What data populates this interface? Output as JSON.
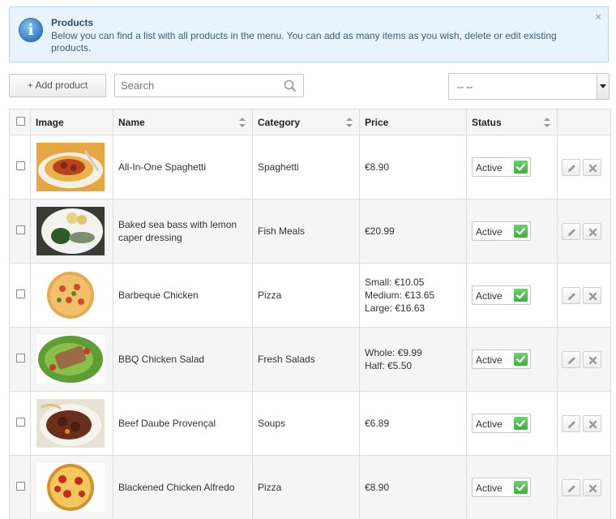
{
  "alert": {
    "title": "Products",
    "text": "Below you can find a list with all products in the menu. You can add as many items as you wish, delete or edit existing products.",
    "close": "×"
  },
  "toolbar": {
    "add_label": "+ Add product",
    "search_placeholder": "Search",
    "filter_value": "-- --"
  },
  "table": {
    "headers": {
      "image": "Image",
      "name": "Name",
      "category": "Category",
      "price": "Price",
      "status": "Status"
    },
    "rows": [
      {
        "name": "All-In-One Spaghetti",
        "category": "Spaghetti",
        "price": [
          "€8.90"
        ],
        "status": "Active",
        "image_icon": "spaghetti-photo"
      },
      {
        "name": "Baked sea bass with lemon caper dressing",
        "category": "Fish Meals",
        "price": [
          "€20.99"
        ],
        "status": "Active",
        "image_icon": "fish-plate-photo"
      },
      {
        "name": "Barbeque Chicken",
        "category": "Pizza",
        "price": [
          "Small: €10.05",
          "Medium: €13.65",
          "Large: €16.63"
        ],
        "status": "Active",
        "image_icon": "pizza-photo"
      },
      {
        "name": "BBQ Chicken Salad",
        "category": "Fresh Salads",
        "price": [
          "Whole: €9.99",
          "Half: €5.50"
        ],
        "status": "Active",
        "image_icon": "salad-photo"
      },
      {
        "name": "Beef Daube Provençal",
        "category": "Soups",
        "price": [
          "€6.89"
        ],
        "status": "Active",
        "image_icon": "beef-stew-photo"
      },
      {
        "name": "Blackened Chicken Alfredo",
        "category": "Pizza",
        "price": [
          "€8.90"
        ],
        "status": "Active",
        "image_icon": "pepperoni-pizza-photo"
      }
    ]
  },
  "colors": {
    "alert_bg": "#e9f3fb",
    "status_check": "#4cbb4c",
    "row_alt": "#f5f5f5"
  }
}
